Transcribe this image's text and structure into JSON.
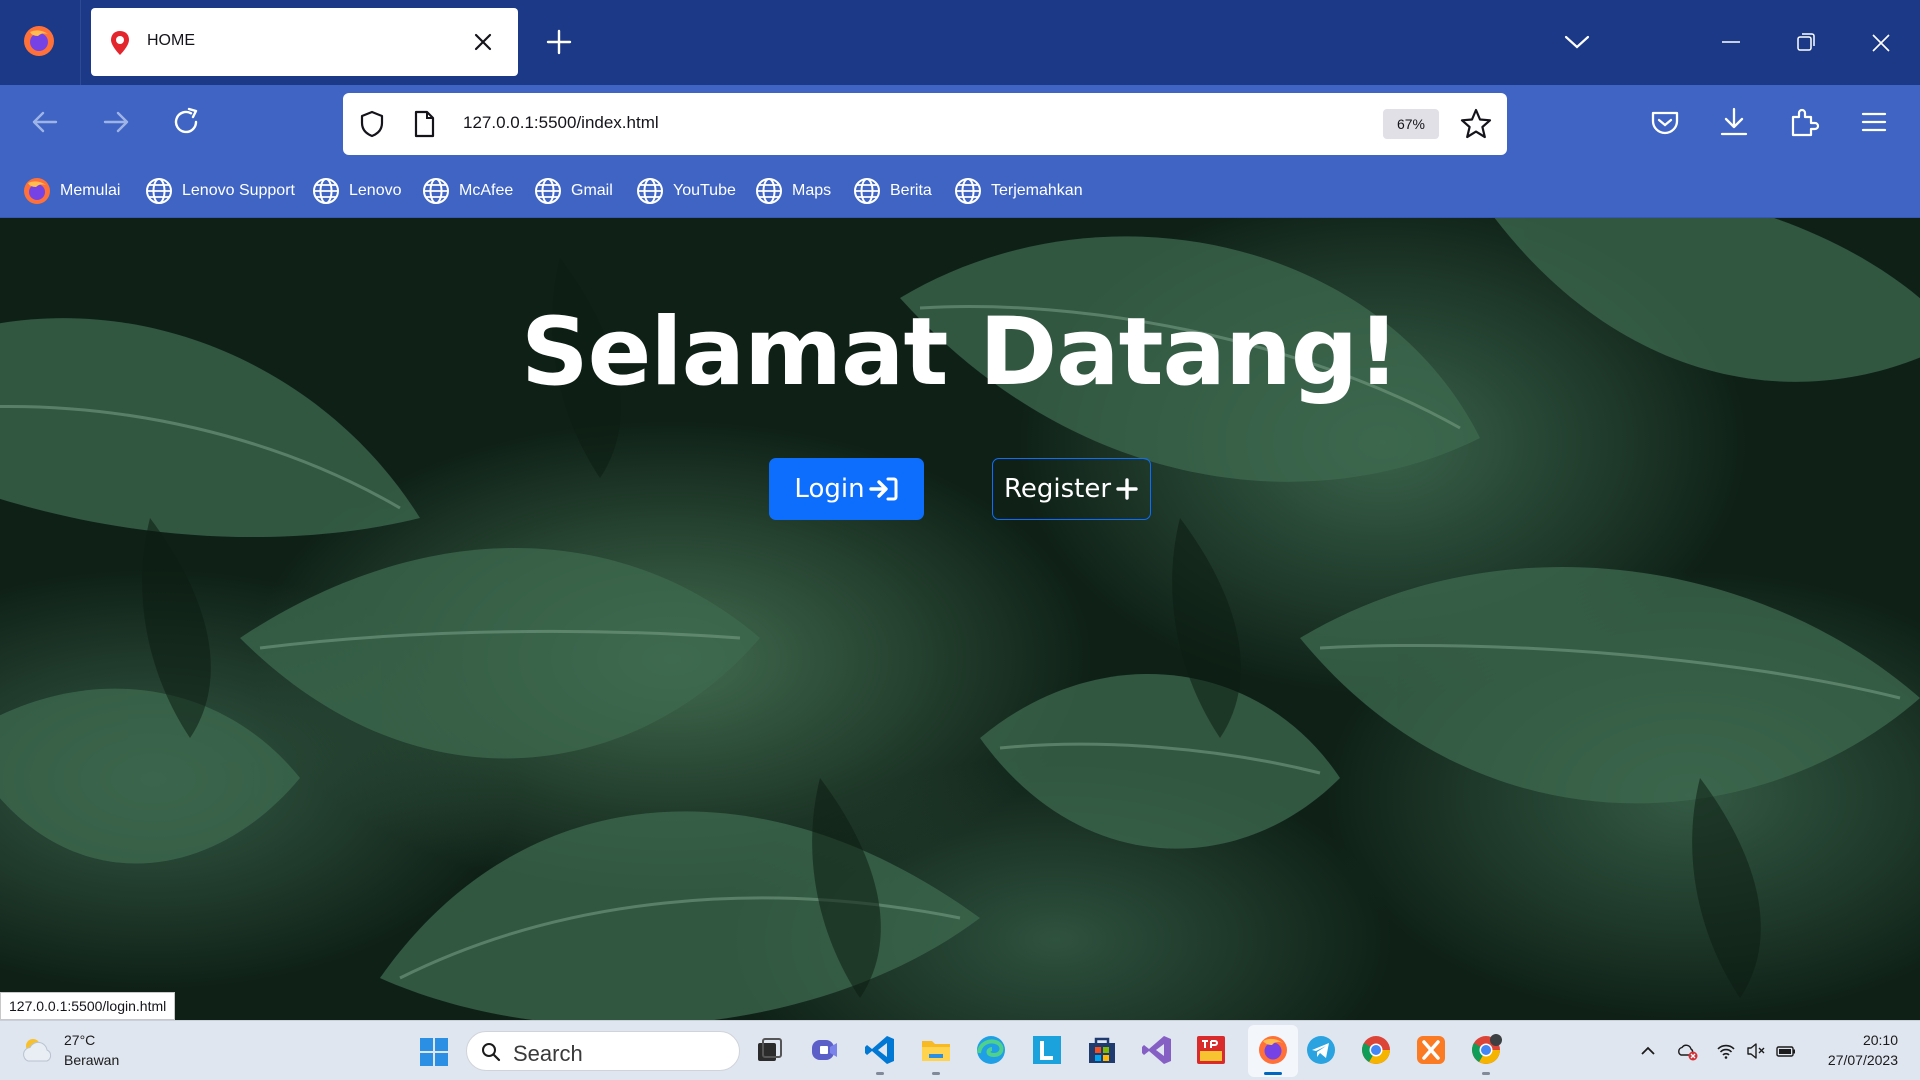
{
  "browser": {
    "tab": {
      "title": "HOME"
    },
    "url": "127.0.0.1:5500/index.html",
    "zoom": "67%",
    "bookmarks": [
      "Memulai",
      "Lenovo Support",
      "Lenovo",
      "McAfee",
      "Gmail",
      "YouTube",
      "Maps",
      "Berita",
      "Terjemahkan"
    ],
    "status_link": "127.0.0.1:5500/login.html"
  },
  "page": {
    "title": "Selamat Datang!",
    "login_label": "Login",
    "register_label": "Register",
    "colors": {
      "primary": "#0d6efd",
      "heading": "#ffffff"
    }
  },
  "taskbar": {
    "weather": {
      "temp": "27°C",
      "desc": "Berawan"
    },
    "search_placeholder": "Search",
    "apps": [
      "task-view",
      "teams",
      "vscode",
      "file-explorer",
      "edge",
      "lenovo-vantage",
      "microsoft-store",
      "visual-studio",
      "wps-office",
      "firefox",
      "telegram",
      "chrome",
      "xampp",
      "chrome-profile"
    ],
    "time": "20:10",
    "date": "27/07/2023"
  },
  "theme": {
    "titlebar": "#1c3987",
    "navbar": "#3f64c3",
    "taskbar": "#dfe6f0"
  }
}
